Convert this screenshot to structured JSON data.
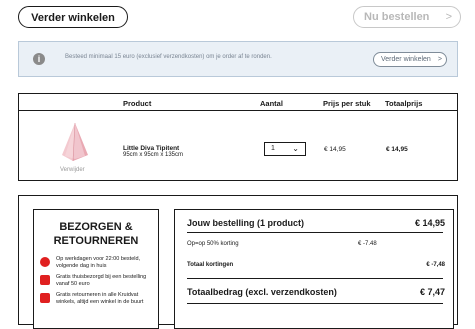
{
  "top_bar": {
    "continue_label": "Verder winkelen",
    "order_label": "Nu bestellen",
    "order_chevron": ">"
  },
  "info_banner": {
    "icon": "info-icon",
    "icon_glyph": "i",
    "text": "Besteed minimaal 15 euro (exclusief verzendkosten) om je order af te ronden.",
    "button_label": "Verder winkelen",
    "button_chevron": ">"
  },
  "cart_table": {
    "headers": {
      "product": "Product",
      "quantity": "Aantal",
      "unit_price": "Prijs per stuk",
      "total_price": "Totaalprijs"
    },
    "item": {
      "name": "Little Diva Tipitent",
      "dimensions": "95cm x 95cm x 135cm",
      "remove_label": "Verwijder",
      "quantity": "1",
      "unit_price": "€ 14,95",
      "total_price": "€ 14,95"
    }
  },
  "delivery": {
    "title_line1": "BEZORGEN &",
    "title_line2": "RETOURNEREN",
    "items": [
      {
        "icon": "clock-icon",
        "text": "Op werkdagen voor 22:00 besteld, volgende dag in huis"
      },
      {
        "icon": "truck-icon",
        "text": "Gratis thuisbezorgd bij een bestelling vanaf 50 euro"
      },
      {
        "icon": "store-icon",
        "text": "Gratis retourneren in alle Kruidvat winkels, altijd een winkel in de buurt"
      }
    ],
    "accent_color": "#e02020"
  },
  "order_summary": {
    "title": "Jouw bestelling (1 product)",
    "amount": "€ 14,95",
    "discount_label": "Op=op 50% korting",
    "discount_value": "€ -7.48",
    "total_discounts_label": "Totaal kortingen",
    "total_discounts_value": "€ -7,48",
    "grand_total_label": "Totaalbedrag (excl. verzendkosten)",
    "grand_total_value": "€ 7,47"
  }
}
